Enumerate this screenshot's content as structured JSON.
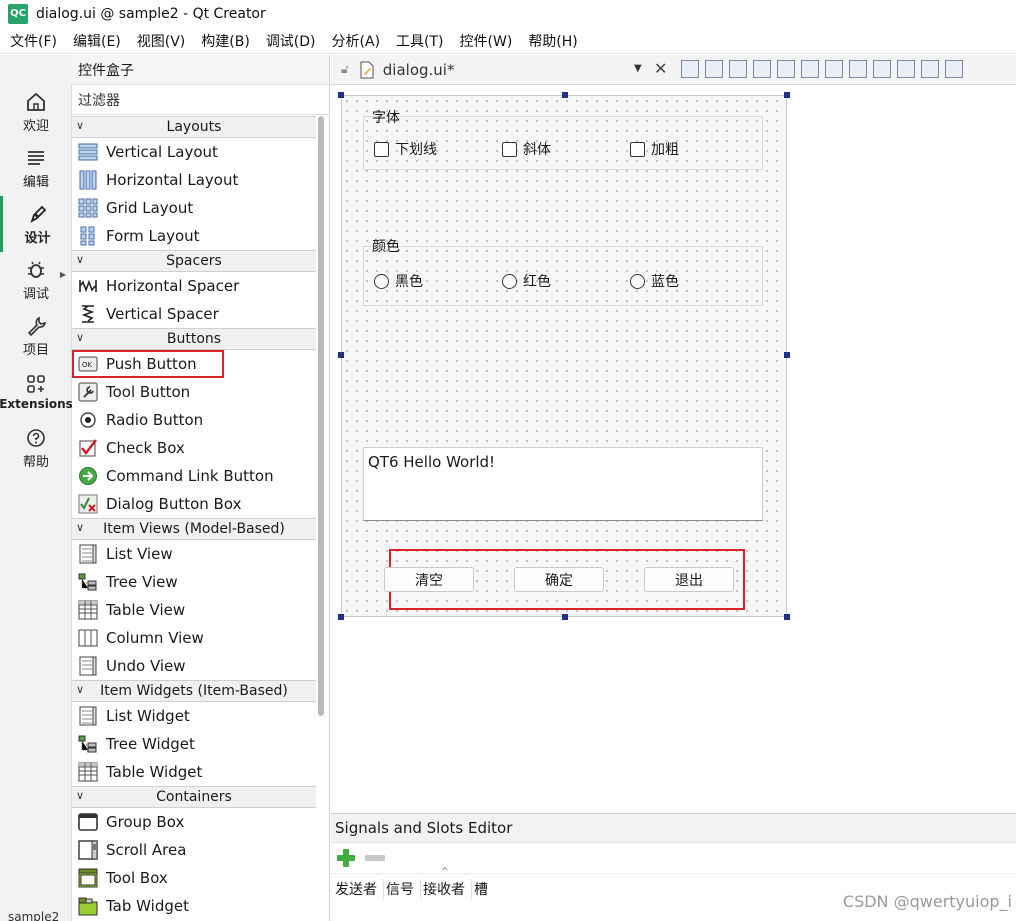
{
  "window": {
    "app_icon_text": "QC",
    "title": "dialog.ui @ sample2 - Qt Creator"
  },
  "menu": [
    "文件(F)",
    "编辑(E)",
    "视图(V)",
    "构建(B)",
    "调试(D)",
    "分析(A)",
    "工具(T)",
    "控件(W)",
    "帮助(H)"
  ],
  "modes": [
    {
      "label": "欢迎",
      "icon": "home-icon"
    },
    {
      "label": "编辑",
      "icon": "edit-lines-icon"
    },
    {
      "label": "设计",
      "icon": "pen-icon",
      "active": true
    },
    {
      "label": "调试",
      "icon": "bug-icon"
    },
    {
      "label": "项目",
      "icon": "wrench-icon"
    },
    {
      "label": "Extensions",
      "icon": "extensions-icon"
    },
    {
      "label": "帮助",
      "icon": "help-icon"
    }
  ],
  "project_tag": "sample2",
  "widget_box": {
    "title": "控件盒子",
    "filter_placeholder": "过滤器",
    "categories": [
      {
        "name": "Layouts",
        "items": [
          "Vertical Layout",
          "Horizontal Layout",
          "Grid Layout",
          "Form Layout"
        ]
      },
      {
        "name": "Spacers",
        "items": [
          "Horizontal Spacer",
          "Vertical Spacer"
        ]
      },
      {
        "name": "Buttons",
        "items": [
          "Push Button",
          "Tool Button",
          "Radio Button",
          "Check Box",
          "Command Link Button",
          "Dialog Button Box"
        ]
      },
      {
        "name": "Item Views (Model-Based)",
        "items": [
          "List View",
          "Tree View",
          "Table View",
          "Column View",
          "Undo View"
        ]
      },
      {
        "name": "Item Widgets (Item-Based)",
        "items": [
          "List Widget",
          "Tree Widget",
          "Table Widget"
        ]
      },
      {
        "name": "Containers",
        "items": [
          "Group Box",
          "Scroll Area",
          "Tool Box",
          "Tab Widget"
        ]
      }
    ]
  },
  "editor": {
    "filename": "dialog.ui*"
  },
  "form": {
    "font_group": {
      "title": "字体",
      "checkboxes": [
        "下划线",
        "斜体",
        "加粗"
      ]
    },
    "color_group": {
      "title": "颜色",
      "radios": [
        "黑色",
        "红色",
        "蓝色"
      ]
    },
    "text_edit_value": "QT6 Hello World!",
    "buttons": [
      "清空",
      "确定",
      "退出"
    ]
  },
  "signals_slots": {
    "title": "Signals and Slots Editor",
    "columns": [
      "发送者",
      "信号",
      "接收者",
      "槽"
    ]
  },
  "watermark": "CSDN @qwertyuiop_i",
  "colors": {
    "highlight_red": "#d9242b",
    "active_mode_green": "#1e9c5a",
    "selection_handle": "#1f2e86"
  }
}
